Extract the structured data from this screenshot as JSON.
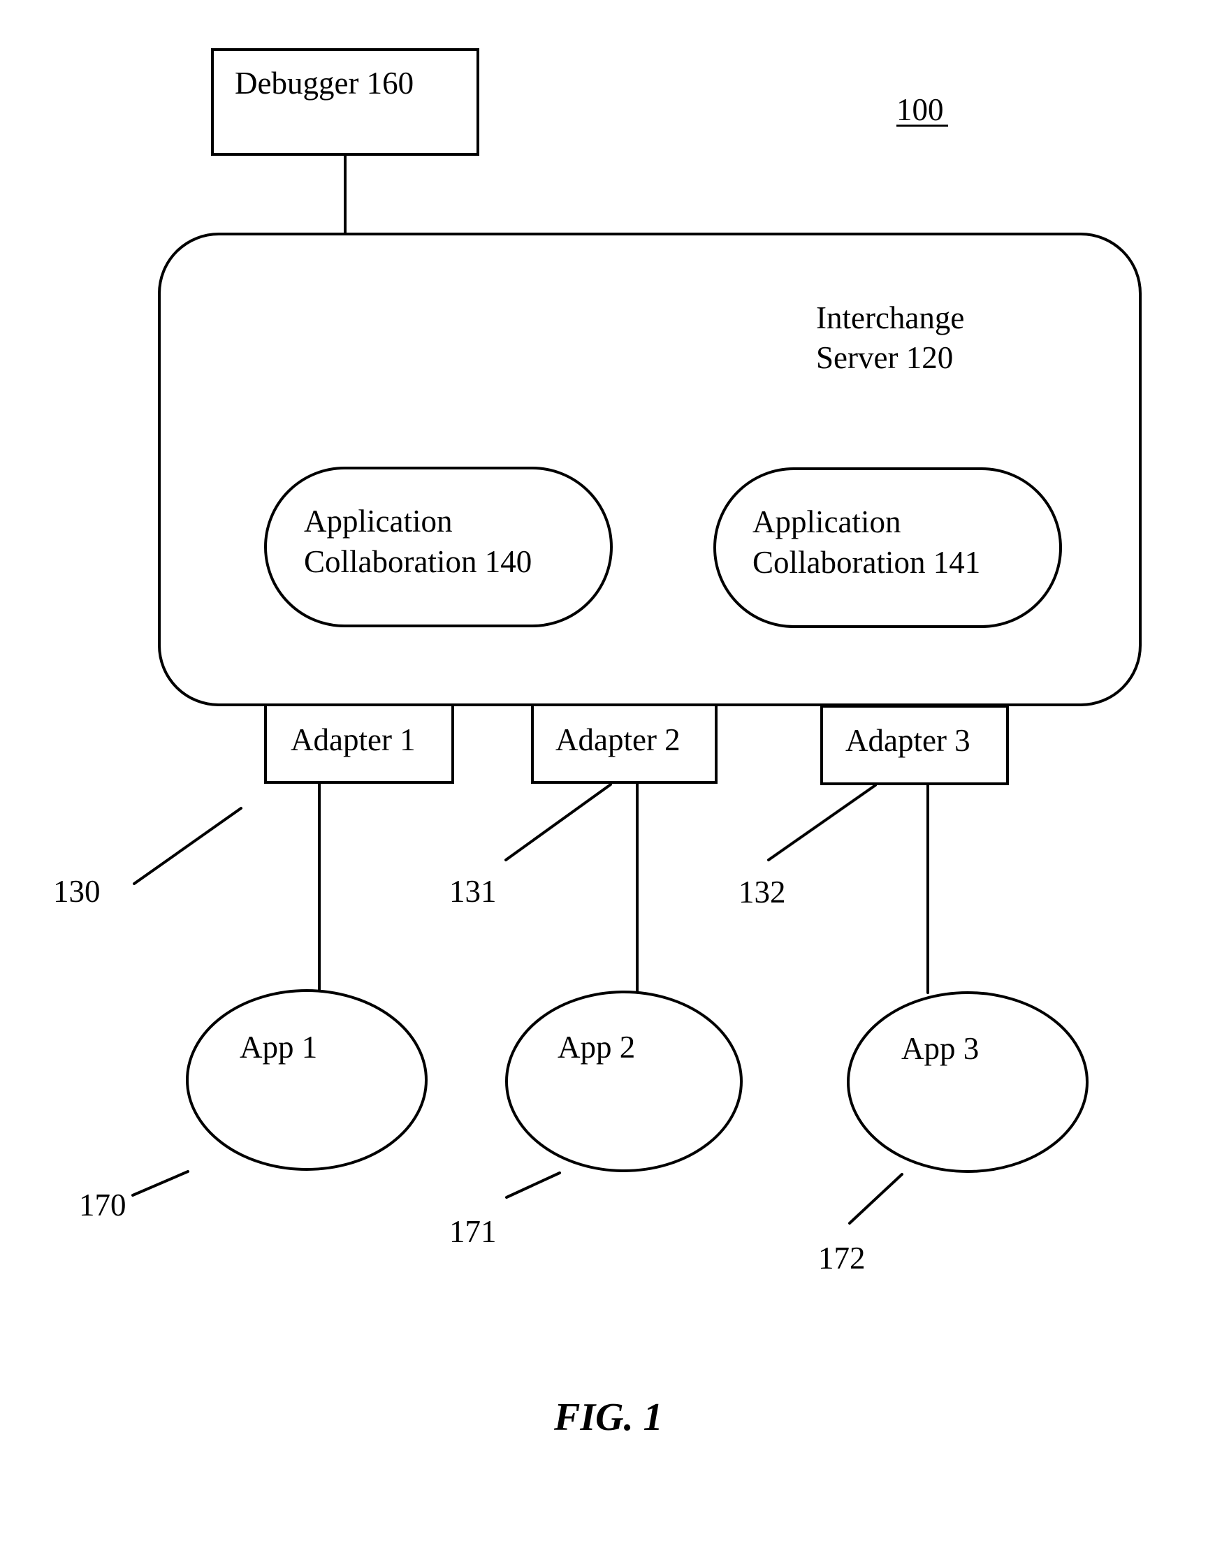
{
  "figure": {
    "reference_number": "100",
    "caption": "FIG. 1"
  },
  "debugger": {
    "label": "Debugger 160"
  },
  "server": {
    "line1": "Interchange",
    "line2": "Server 120"
  },
  "collaborations": [
    {
      "line1": "Application",
      "line2": "Collaboration 140"
    },
    {
      "line1": "Application",
      "line2": "Collaboration 141"
    }
  ],
  "adapters": [
    {
      "label": "Adapter 1",
      "ref": "130"
    },
    {
      "label": "Adapter 2",
      "ref": "131"
    },
    {
      "label": "Adapter 3",
      "ref": "132"
    }
  ],
  "apps": [
    {
      "label": "App 1",
      "ref": "170"
    },
    {
      "label": "App 2",
      "ref": "171"
    },
    {
      "label": "App 3",
      "ref": "172"
    }
  ]
}
